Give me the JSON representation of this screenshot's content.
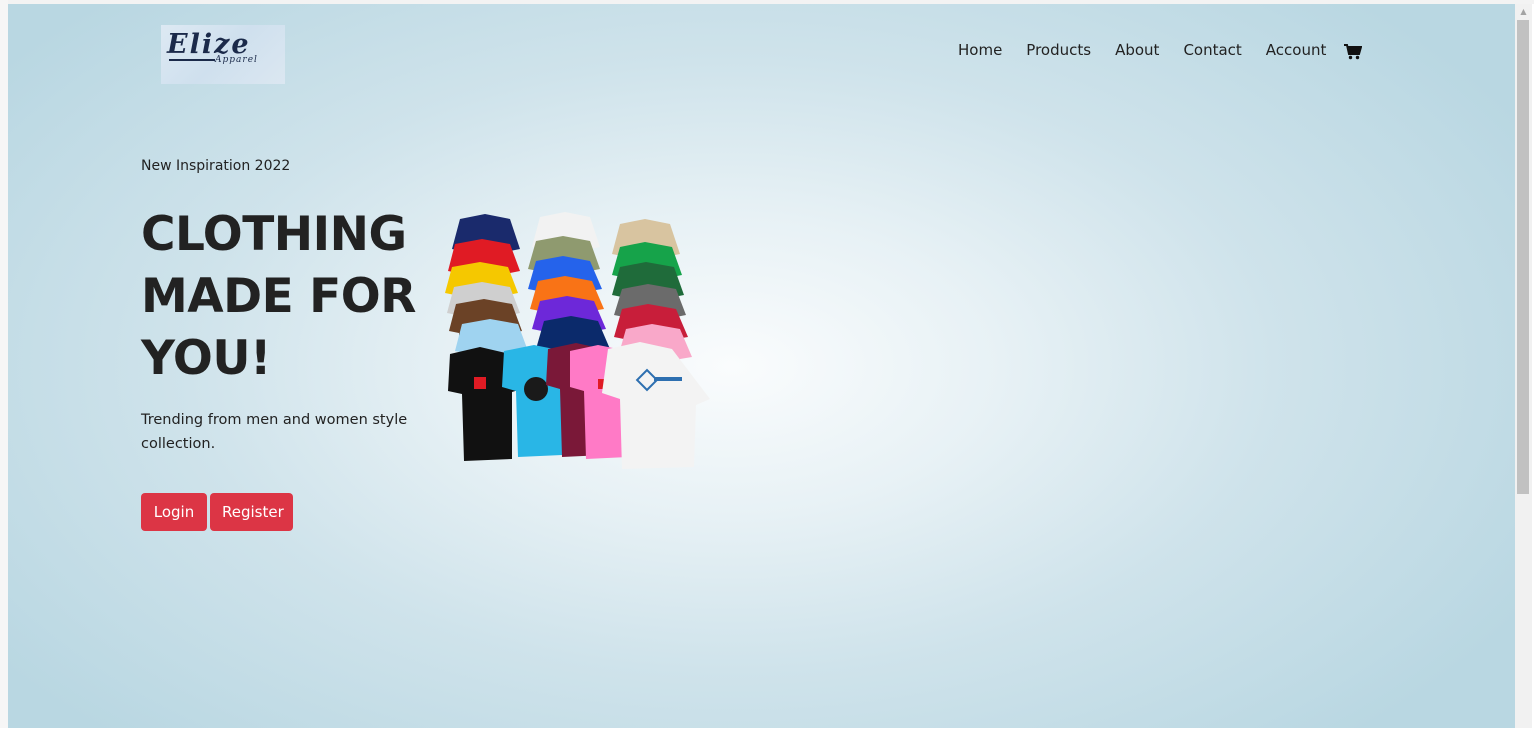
{
  "brand": {
    "logo_text": "Elize",
    "logo_subtext": "Apparel"
  },
  "nav": {
    "items": [
      "Home",
      "Products",
      "About",
      "Contact",
      "Account"
    ],
    "cart_icon": "shopping-cart-icon"
  },
  "hero": {
    "eyebrow": "New Inspiration 2022",
    "headline": "CLOTHING MADE FOR YOU!",
    "subtext": "Trending from men and women style collection.",
    "login_label": "Login",
    "register_label": "Register"
  },
  "colors": {
    "accent": "#dc3545",
    "background_center": "#fafcfd",
    "background_edge": "#b9d7e2",
    "text": "#222222"
  }
}
